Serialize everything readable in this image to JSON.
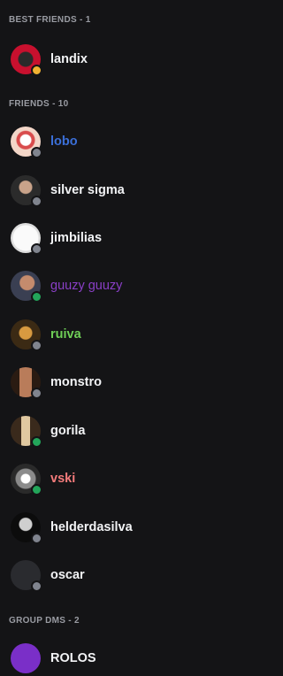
{
  "sections": {
    "best_friends": "BEST FRIENDS - 1",
    "friends": "FRIENDS - 10",
    "group_dms": "GROUP DMS - 2"
  },
  "best_friends": [
    {
      "name": "landix",
      "name_color": "#f2f3f5",
      "status": "idle",
      "status_color": "#f0b232",
      "avatar_icon": "landix-avatar"
    }
  ],
  "friends": [
    {
      "name": "lobo",
      "name_color": "#3b6fd8",
      "status": "offline",
      "status_color": "#80848e"
    },
    {
      "name": "silver sigma",
      "name_color": "#f2f3f5",
      "status": "offline",
      "status_color": "#80848e"
    },
    {
      "name": "jimbilias",
      "name_color": "#f2f3f5",
      "status": "offline",
      "status_color": "#80848e"
    },
    {
      "name": "guuzy guuzy",
      "name_color": "#8a3fc7",
      "status": "online",
      "status_color": "#23a55a"
    },
    {
      "name": "ruiva",
      "name_color": "#6fcf57",
      "status": "offline",
      "status_color": "#80848e"
    },
    {
      "name": "monstro",
      "name_color": "#f2f3f5",
      "status": "offline",
      "status_color": "#80848e"
    },
    {
      "name": "gorila",
      "name_color": "#f2f3f5",
      "status": "online",
      "status_color": "#23a55a"
    },
    {
      "name": "vski",
      "name_color": "#f47b7b",
      "status": "online",
      "status_color": "#23a55a"
    },
    {
      "name": "helderdasilva",
      "name_color": "#f2f3f5",
      "status": "offline",
      "status_color": "#80848e"
    },
    {
      "name": "oscar",
      "name_color": "#f2f3f5",
      "status": "offline",
      "status_color": "#80848e"
    }
  ],
  "group_dms": [
    {
      "name": "ROLOS"
    }
  ]
}
